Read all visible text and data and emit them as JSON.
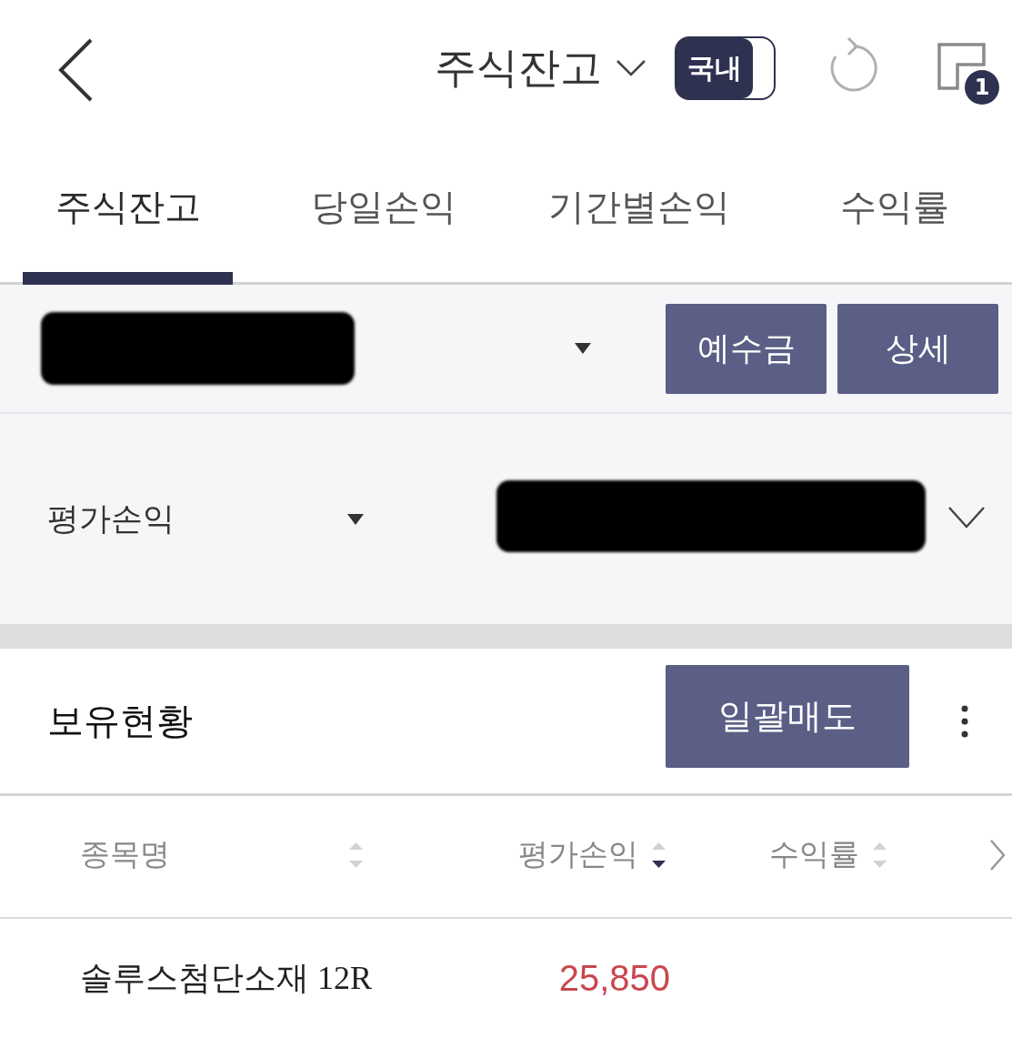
{
  "header": {
    "title": "주식잔고",
    "toggle": {
      "label": "국내",
      "on": true
    },
    "badge": "1"
  },
  "tabs": [
    {
      "label": "주식잔고",
      "selected": true
    },
    {
      "label": "당일손익",
      "selected": false
    },
    {
      "label": "기간별손익",
      "selected": false
    },
    {
      "label": "수익률",
      "selected": false
    }
  ],
  "account": {
    "buttons": [
      "예수금",
      "상세"
    ]
  },
  "summary": {
    "label": "평가손익"
  },
  "holdings": {
    "title": "보유현황",
    "button": "일괄매도"
  },
  "table": {
    "columns": [
      {
        "label": "종목명",
        "sorted_descending": false
      },
      {
        "label": "평가손익",
        "sorted_descending": true
      },
      {
        "label": "수익률",
        "sorted_descending": false
      }
    ],
    "rows": [
      {
        "name": "솔루스첨단소재 12R",
        "profit": "25,850",
        "gain": true
      }
    ]
  }
}
